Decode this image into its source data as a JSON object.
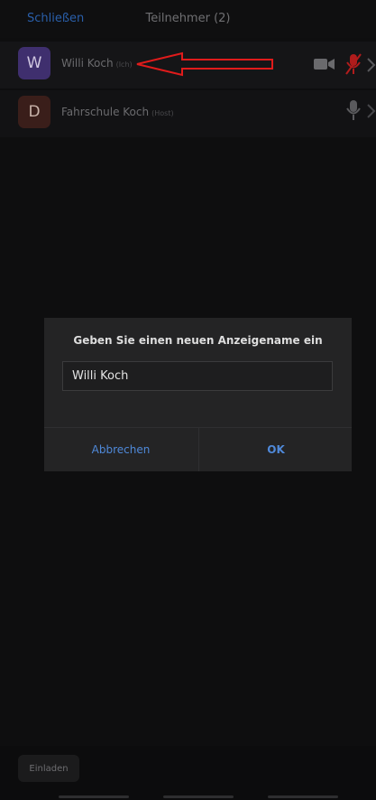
{
  "header": {
    "close_label": "Schließen",
    "title": "Teilnehmer (2)"
  },
  "participants": [
    {
      "avatar_letter": "W",
      "name": "Willi Koch",
      "tag": "(Ich)",
      "avatar_color": "#3f2f6e",
      "video_icon": "video-camera-icon",
      "mic_icon": "mic-off-icon"
    },
    {
      "avatar_letter": "D",
      "name": "Fahrschule Koch",
      "tag": "(Host)",
      "avatar_color": "#3a1e1a",
      "mic_icon": "mic-icon"
    }
  ],
  "dialog": {
    "title": "Geben Sie einen neuen Anzeigename ein",
    "input_value": "Willi Koch",
    "cancel_label": "Abbrechen",
    "ok_label": "OK"
  },
  "bottom": {
    "invite_label": "Einladen"
  },
  "colors": {
    "accent": "#4f89d9",
    "annotation": "#e01b1b",
    "mic_muted": "#b11c1c"
  }
}
